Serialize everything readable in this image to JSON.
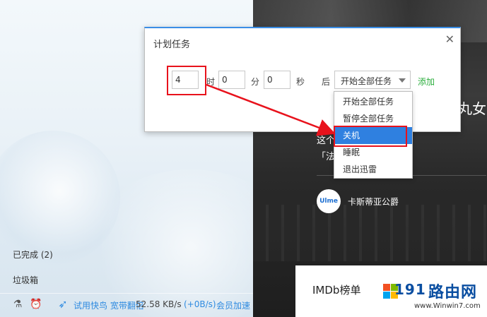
{
  "left_panel": {
    "completed": "已完成 (2)",
    "trash": "垃圾箱",
    "bottom": {
      "ad_text": "试用快鸟 宽带翻倍",
      "speed": "52.58 KB/s",
      "speed_plus": "(+0B/s)",
      "accelerate": "会员加速"
    }
  },
  "right_panel": {
    "title_fragment": "丸女",
    "desc_line1": "这个           的新娘「KIDDO」",
    "desc_line2": "「法",
    "avatar_text": "Ulme",
    "author": "卡斯蒂亚公爵",
    "imdb_label": "IMDb榜单"
  },
  "watermark": {
    "num": "191",
    "cn": "路由网",
    "url": "www.Winwin7.com"
  },
  "dialog": {
    "title": "计划任务",
    "close": "✕",
    "hour_value": "4",
    "hour_unit": "时",
    "minute_value": "0",
    "minute_unit": "分",
    "second_value": "0",
    "second_unit": "秒",
    "after": "后",
    "selected_action": "开始全部任务",
    "add": "添加"
  },
  "dropdown": {
    "options": [
      "开始全部任务",
      "暂停全部任务",
      "关机",
      "睡眠",
      "退出迅雷"
    ],
    "highlighted_index": 2
  },
  "colors": {
    "accent_blue": "#2f80e0",
    "add_green": "#2cae3e",
    "highlight_red": "#e8121c"
  }
}
